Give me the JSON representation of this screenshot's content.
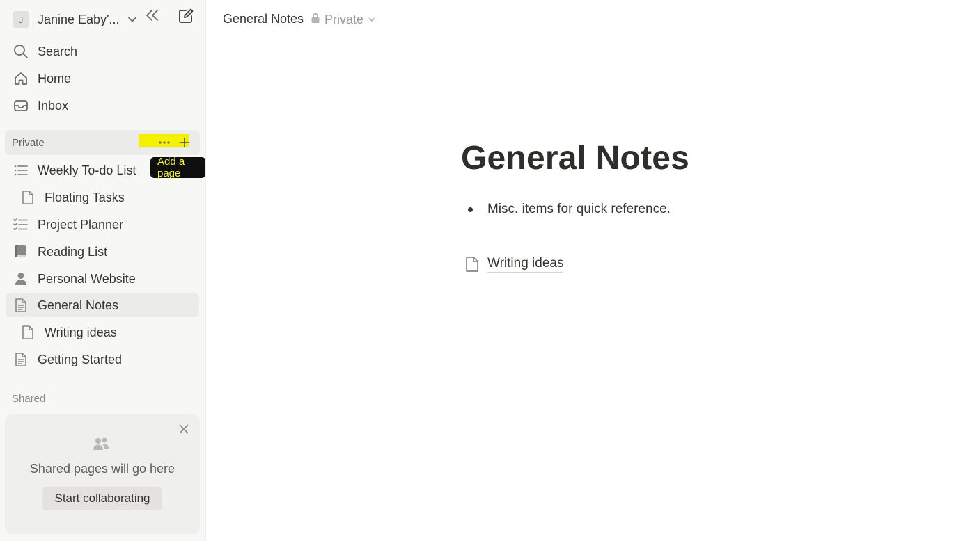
{
  "workspace": {
    "avatar_letter": "J",
    "name": "Janine Eaby'..."
  },
  "nav": {
    "search": "Search",
    "home": "Home",
    "inbox": "Inbox"
  },
  "private_section": {
    "label": "Private",
    "tooltip": "Add a page",
    "pages": [
      {
        "label": "Weekly To-do List",
        "icon": "list-icon"
      },
      {
        "label": "Floating Tasks",
        "icon": "page-icon"
      },
      {
        "label": "Project Planner",
        "icon": "checklist-icon"
      },
      {
        "label": "Reading List",
        "icon": "book-icon"
      },
      {
        "label": "Personal Website",
        "icon": "person-icon"
      },
      {
        "label": "General Notes",
        "icon": "document-icon"
      },
      {
        "label": "Writing ideas",
        "icon": "page-icon"
      },
      {
        "label": "Getting Started",
        "icon": "document-icon"
      }
    ]
  },
  "shared_section": {
    "label": "Shared",
    "empty_text": "Shared pages will go here",
    "button": "Start collaborating"
  },
  "topbar": {
    "breadcrumb": "General Notes",
    "privacy": "Private"
  },
  "page": {
    "title": "General Notes",
    "bullet": "Misc. items for quick reference.",
    "subpage": "Writing ideas"
  },
  "colors": {
    "sidebar_bg": "#f7f7f5",
    "active_bg": "#ebebea",
    "highlight": "#f4f000",
    "tooltip_bg": "#0f0f0f",
    "tooltip_text": "#f7ef4f"
  }
}
